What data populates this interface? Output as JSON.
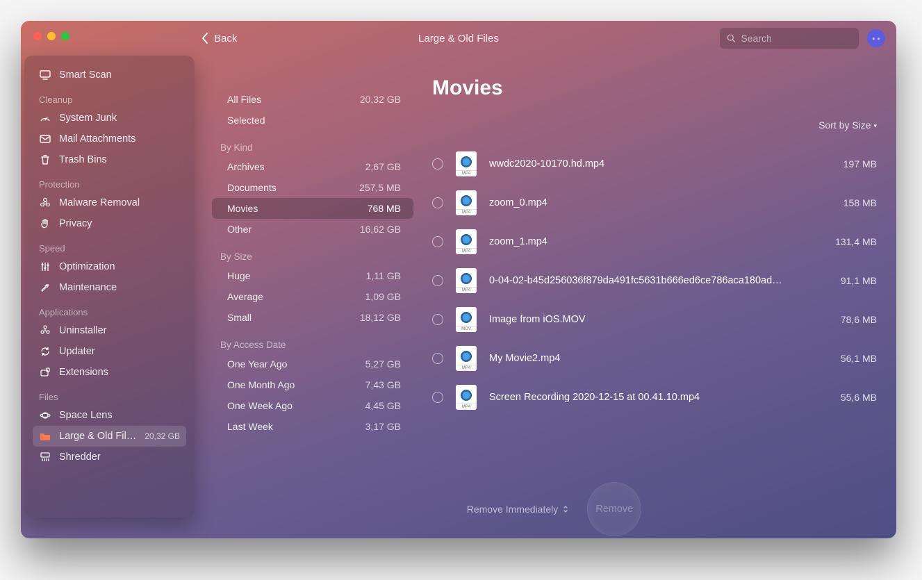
{
  "header": {
    "back_label": "Back",
    "title": "Large & Old Files",
    "search_placeholder": "Search"
  },
  "sidebar": {
    "top": {
      "label": "Smart Scan"
    },
    "sections": [
      {
        "title": "Cleanup",
        "items": [
          {
            "label": "System Junk"
          },
          {
            "label": "Mail Attachments"
          },
          {
            "label": "Trash Bins"
          }
        ]
      },
      {
        "title": "Protection",
        "items": [
          {
            "label": "Malware Removal"
          },
          {
            "label": "Privacy"
          }
        ]
      },
      {
        "title": "Speed",
        "items": [
          {
            "label": "Optimization"
          },
          {
            "label": "Maintenance"
          }
        ]
      },
      {
        "title": "Applications",
        "items": [
          {
            "label": "Uninstaller"
          },
          {
            "label": "Updater"
          },
          {
            "label": "Extensions"
          }
        ]
      },
      {
        "title": "Files",
        "items": [
          {
            "label": "Space Lens"
          },
          {
            "label": "Large & Old Fil…",
            "badge": "20,32 GB",
            "active": true
          },
          {
            "label": "Shredder"
          }
        ]
      }
    ]
  },
  "filters": {
    "top": [
      {
        "label": "All Files",
        "value": "20,32 GB"
      },
      {
        "label": "Selected",
        "value": ""
      }
    ],
    "groups": [
      {
        "title": "By Kind",
        "items": [
          {
            "label": "Archives",
            "value": "2,67 GB"
          },
          {
            "label": "Documents",
            "value": "257,5 MB"
          },
          {
            "label": "Movies",
            "value": "768 MB",
            "selected": true
          },
          {
            "label": "Other",
            "value": "16,62 GB"
          }
        ]
      },
      {
        "title": "By Size",
        "items": [
          {
            "label": "Huge",
            "value": "1,11 GB"
          },
          {
            "label": "Average",
            "value": "1,09 GB"
          },
          {
            "label": "Small",
            "value": "18,12 GB"
          }
        ]
      },
      {
        "title": "By Access Date",
        "items": [
          {
            "label": "One Year Ago",
            "value": "5,27 GB"
          },
          {
            "label": "One Month Ago",
            "value": "7,43 GB"
          },
          {
            "label": "One Week Ago",
            "value": "4,45 GB"
          },
          {
            "label": "Last Week",
            "value": "3,17 GB"
          }
        ]
      }
    ]
  },
  "main": {
    "heading": "Movies",
    "sort_label": "Sort by Size",
    "files": [
      {
        "name": "wwdc2020-10170.hd.mp4",
        "size": "197 MB",
        "ext": "MP4"
      },
      {
        "name": "zoom_0.mp4",
        "size": "158 MB",
        "ext": "MP4"
      },
      {
        "name": "zoom_1.mp4",
        "size": "131,4 MB",
        "ext": "MP4"
      },
      {
        "name": "0-04-02-b45d256036f879da491fc5631b666ed6ce786aca180ad…",
        "size": "91,1 MB",
        "ext": "MP4"
      },
      {
        "name": "Image from iOS.MOV",
        "size": "78,6 MB",
        "ext": "MOV"
      },
      {
        "name": "My Movie2.mp4",
        "size": "56,1 MB",
        "ext": "MP4"
      },
      {
        "name": "Screen Recording 2020-12-15 at 00.41.10.mp4",
        "size": "55,6 MB",
        "ext": "MP4"
      }
    ]
  },
  "bottom": {
    "mode_label": "Remove Immediately",
    "button_label": "Remove"
  },
  "icons": {
    "smart_scan": "monitor-icon",
    "system_junk": "gauge-icon",
    "mail": "envelope-icon",
    "trash": "trash-icon",
    "malware": "biohazard-icon",
    "privacy": "hand-icon",
    "optimization": "sliders-icon",
    "maintenance": "wrench-icon",
    "uninstaller": "puzzle-icon",
    "updater": "refresh-icon",
    "extensions": "plugin-icon",
    "space_lens": "orbit-icon",
    "large_old": "folder-icon",
    "shredder": "shredder-icon"
  }
}
